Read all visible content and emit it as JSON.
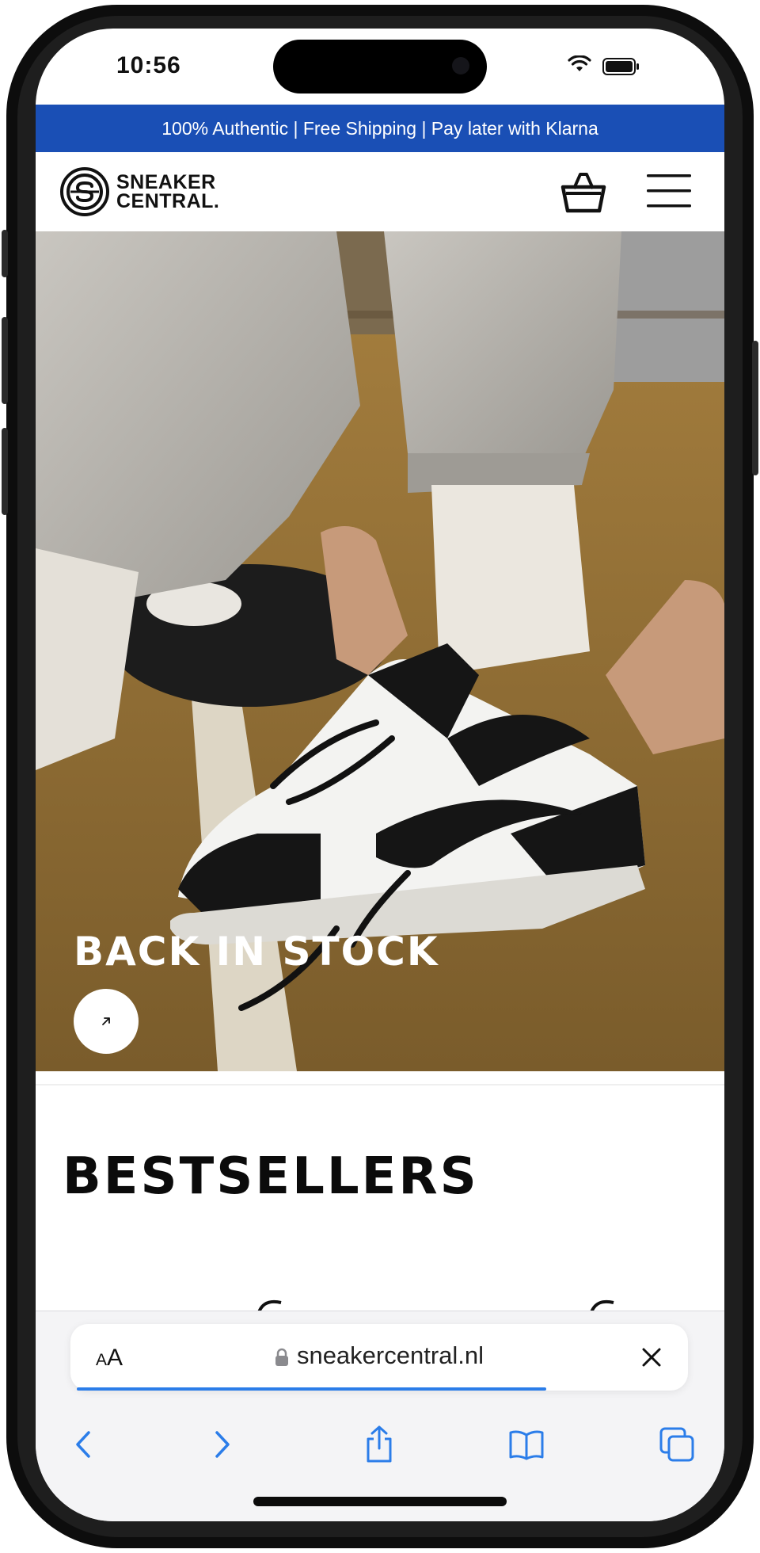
{
  "status_bar": {
    "time": "10:56"
  },
  "promo_banner": {
    "text": "100% Authentic | Free Shipping | Pay later with Klarna"
  },
  "header": {
    "logo_line1": "SNEAKER",
    "logo_line2": "CENTRAL."
  },
  "hero": {
    "title": "BACK IN STOCK"
  },
  "bestsellers": {
    "title": "BESTSELLERS"
  },
  "browser": {
    "text_size_small": "A",
    "text_size_large": "A",
    "url": "sneakercentral.nl",
    "load_progress": 0.76
  },
  "colors": {
    "banner_blue": "#1a4fb5",
    "safari_blue": "#2b7de9",
    "text_black": "#0b0b0b"
  }
}
